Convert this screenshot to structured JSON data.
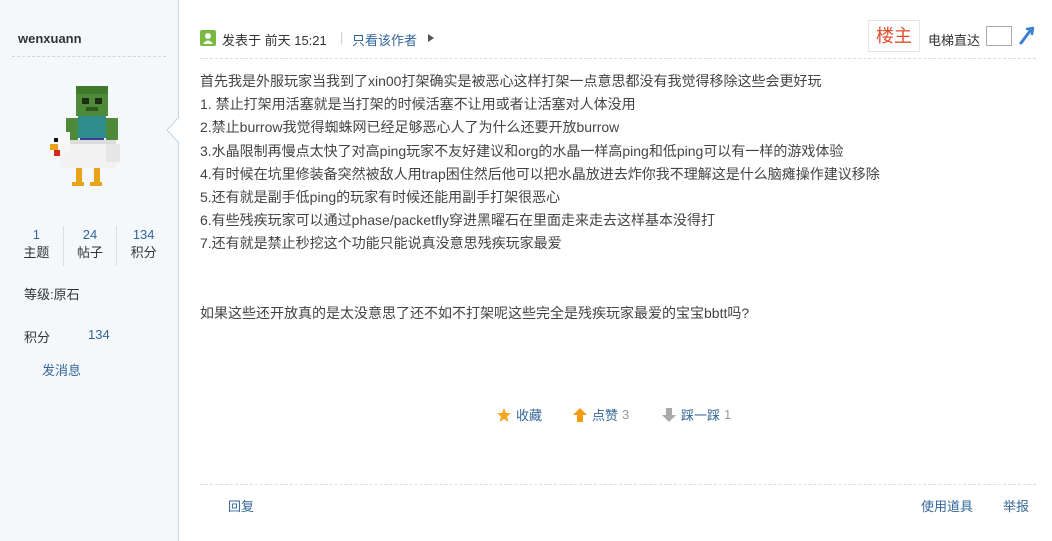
{
  "author": {
    "name": "wenxuann",
    "avatar_icon": "minecraft-zombie-chicken-jockey-icon",
    "stats": [
      {
        "value": "1",
        "label": "主题"
      },
      {
        "value": "24",
        "label": "帖子"
      },
      {
        "value": "134",
        "label": "积分"
      }
    ],
    "level": "等级:原石",
    "points_label": "积分",
    "points_value": "134",
    "message_link": "发消息"
  },
  "header": {
    "posted_on": "发表于 前天 15:21",
    "separator": "|",
    "author_only": "只看该作者",
    "floor_badge": "楼主",
    "elevator_label": "电梯直达"
  },
  "content": {
    "lines": [
      "首先我是外服玩家当我到了xin00打架确实是被恶心这样打架一点意思都没有我觉得移除这些会更好玩",
      "1. 禁止打架用活塞就是当打架的时候活塞不让用或者让活塞对人体没用",
      "2.禁止burrow我觉得蜘蛛网已经足够恶心人了为什么还要开放burrow",
      "3.水晶限制再慢点太快了对高ping玩家不友好建议和org的水晶一样高ping和低ping可以有一样的游戏体验",
      "4.有时候在坑里修装备突然被敌人用trap困住然后他可以把水晶放进去炸你我不理解这是什么脑瘫操作建议移除",
      "5.还有就是副手低ping的玩家有时候还能用副手打架很恶心",
      "6.有些残疾玩家可以通过phase/packetfly穿进黑曜石在里面走来走去这样基本没得打",
      "7.还有就是禁止秒挖这个功能只能说真没意思残疾玩家最爱"
    ],
    "closing": "如果这些还开放真的是太没意思了还不如不打架呢这些完全是残疾玩家最爱的宝宝bbtt吗?"
  },
  "actions": {
    "favorite": {
      "label": "收藏",
      "icon": "star-icon",
      "color": "#f5a623"
    },
    "upvote": {
      "label": "点赞",
      "count": "3",
      "icon": "arrow-up-icon",
      "color": "#f39c12"
    },
    "downvote": {
      "label": "踩一踩",
      "count": "1",
      "icon": "arrow-down-icon",
      "color": "#aaaaaa"
    }
  },
  "footer": {
    "reply": "回复",
    "use_tool": "使用道具",
    "report": "举报"
  },
  "colors": {
    "link": "#336699",
    "sidebar_bg": "#f5f8fb",
    "floor_badge": "#e24d2b"
  }
}
